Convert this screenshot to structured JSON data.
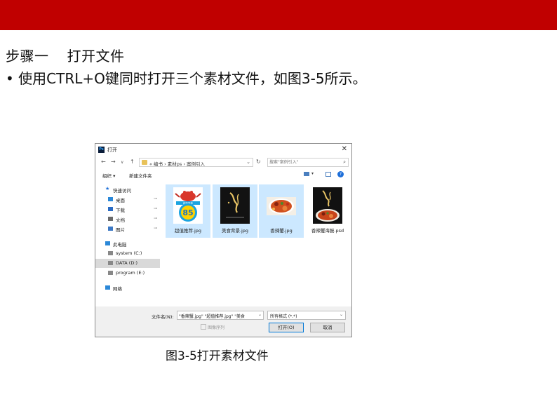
{
  "slide": {
    "heading": "步骤一",
    "heading_step": "打开文件",
    "bullet": "• 使用CTRL+O键同时打开三个素材文件，如图3-5所示。",
    "caption": "图3-5打开素材文件",
    "accent_color": "#c00000"
  },
  "dialog": {
    "app_icon": "Ps",
    "title": "打开",
    "close": "✕",
    "nav": {
      "back": "←",
      "forward": "→",
      "down": "∨",
      "up": "↑"
    },
    "address": {
      "crumbs": "« 编书 › 素材ps › 案例引入",
      "dropdown": "⌄"
    },
    "refresh": "↻",
    "search": {
      "placeholder": "搜索\"案例引入\"",
      "icon": "search-icon"
    },
    "toolbar": {
      "organize": "组织 ▾",
      "new_folder": "新建文件夹",
      "help": "?",
      "view_dd": "▾"
    },
    "sidebar": [
      {
        "label": "快速访问",
        "icon": "star-icon",
        "color": "#1e6fd9"
      },
      {
        "label": "桌面",
        "icon": "desktop-icon",
        "color": "#2b88d8",
        "pin": true
      },
      {
        "label": "下载",
        "icon": "download-icon",
        "color": "#2b6cc4",
        "pin": true
      },
      {
        "label": "文档",
        "icon": "document-icon",
        "color": "#6a6a6a",
        "pin": true
      },
      {
        "label": "图片",
        "icon": "pictures-icon",
        "color": "#3c78c4",
        "pin": true
      },
      {
        "label": "此电脑",
        "icon": "computer-icon",
        "color": "#2b88d8"
      },
      {
        "label": "system (C:)",
        "icon": "drive-icon",
        "color": "#888888"
      },
      {
        "label": "DATA (D:)",
        "icon": "drive-icon",
        "color": "#888888",
        "selected": true
      },
      {
        "label": "program (E:)",
        "icon": "drive-icon",
        "color": "#888888"
      },
      {
        "label": "网络",
        "icon": "network-icon",
        "color": "#2b88d8"
      }
    ],
    "pin_glyph": "📌",
    "files": [
      {
        "name": "超值推荐.jpg",
        "selected": true,
        "badge": "85",
        "badge_sub": "超值推荐"
      },
      {
        "name": "美食背景.jpg",
        "selected": true
      },
      {
        "name": "香辣蟹.jpg",
        "selected": true
      },
      {
        "name": "香辣蟹海报.psd",
        "selected": false
      }
    ],
    "filename_label": "文件名(N):",
    "filename_value": "\"香辣蟹.jpg\" \"超值推荐.jpg\" \"美食",
    "filetype": "所有格式 (*.*)",
    "image_sequence": "图像序列",
    "open_button": "打开(O)",
    "cancel_button": "取消"
  }
}
